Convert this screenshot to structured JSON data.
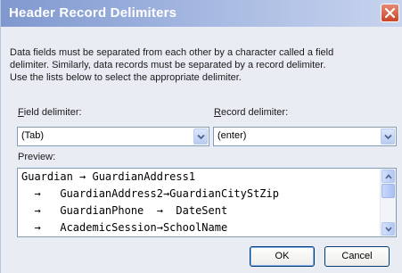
{
  "window": {
    "title": "Header Record Delimiters",
    "close_icon": "close-x-icon"
  },
  "description": {
    "lines": [
      "Data fields must be separated from each other by a character called a field",
      "delimiter. Similarly, data records must be separated by a record delimiter.",
      "Use the lists below to select the appropriate delimiter."
    ]
  },
  "field_delimiter": {
    "label_accel": "F",
    "label_rest": "ield delimiter:",
    "value": "(Tab)"
  },
  "record_delimiter": {
    "label_accel": "R",
    "label_rest": "ecord delimiter:",
    "value": "(enter)"
  },
  "preview": {
    "label": "Preview:",
    "lines": [
      "Guardian → GuardianAddress1",
      "  →   GuardianAddress2→GuardianCityStZip",
      "  →   GuardianPhone  →  DateSent",
      "  →   AcademicSession→SchoolName"
    ]
  },
  "buttons": {
    "ok": "OK",
    "cancel": "Cancel"
  },
  "colors": {
    "titlebar_start": "#7f98cf",
    "titlebar_end": "#c8d4ee",
    "dialog_bg": "#e9ecf3",
    "close_button": "#c94427",
    "field_border": "#7f9db9"
  }
}
